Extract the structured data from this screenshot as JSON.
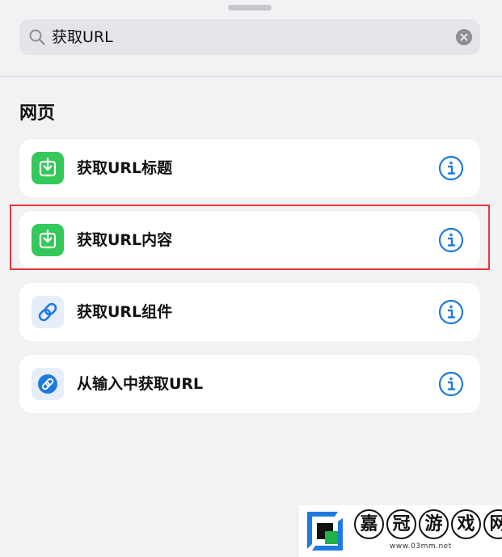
{
  "search": {
    "value": "获取URL",
    "placeholder": ""
  },
  "section": {
    "title": "网页"
  },
  "actions": [
    {
      "label": "获取URL标题",
      "icon": "download-icon",
      "icon_bg": "#34c759"
    },
    {
      "label": "获取URL内容",
      "icon": "download-icon",
      "icon_bg": "#34c759",
      "highlighted": true
    },
    {
      "label": "获取URL组件",
      "icon": "link-icon",
      "icon_bg": "#e6eefb"
    },
    {
      "label": "从输入中获取URL",
      "icon": "link-circle-icon",
      "icon_bg": "#e6eefb"
    }
  ],
  "colors": {
    "accent_blue": "#1f7ae0",
    "highlight_red": "#e03a3a",
    "green": "#34c759"
  },
  "watermark": {
    "chars": [
      "嘉",
      "冠",
      "游",
      "戏",
      "网"
    ],
    "url": "www.03mm.net"
  }
}
